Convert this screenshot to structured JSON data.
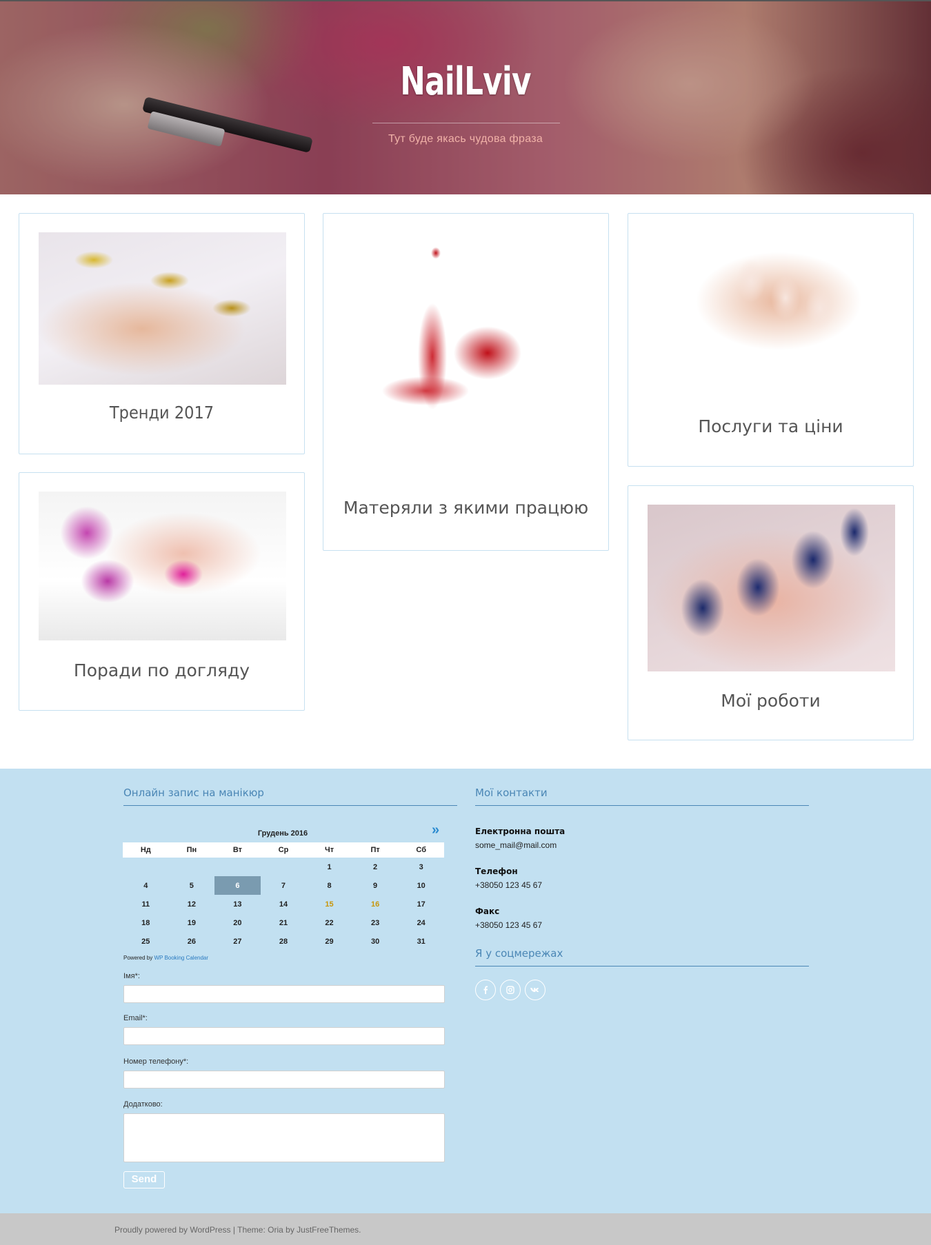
{
  "header": {
    "site_title": "NailLviv",
    "tagline": "Тут буде якась чудова фраза"
  },
  "cards": [
    {
      "title": "Тренди 2017",
      "image": "gold-nails-photo"
    },
    {
      "title": "Матеряли з якими працюю",
      "image": "red-nail-polish-photo"
    },
    {
      "title": "Послуги та ціни",
      "image": "french-manicure-photo"
    },
    {
      "title": "Поради по догляду",
      "image": "pink-nails-orchid-photo"
    },
    {
      "title": "Мої роботи",
      "image": "navy-nail-art-photo"
    }
  ],
  "booking": {
    "widget_title": "Онлайн запис на манікюр",
    "calendar": {
      "month": "Грудень 2016",
      "next_label": "»",
      "weekdays": [
        "Нд",
        "Пн",
        "Вт",
        "Ср",
        "Чт",
        "Пт",
        "Сб"
      ],
      "weeks": [
        [
          "",
          "",
          "",
          "",
          "1",
          "2",
          "3"
        ],
        [
          "4",
          "5",
          "6",
          "7",
          "8",
          "9",
          "10"
        ],
        [
          "11",
          "12",
          "13",
          "14",
          "15",
          "16",
          "17"
        ],
        [
          "18",
          "19",
          "20",
          "21",
          "22",
          "23",
          "24"
        ],
        [
          "25",
          "26",
          "27",
          "28",
          "29",
          "30",
          "31"
        ]
      ],
      "today": "6",
      "highlighted": [
        "15",
        "16"
      ]
    },
    "powered_prefix": "Powered by",
    "powered_link": "WP Booking Calendar",
    "form": {
      "name_label": "Імя*:",
      "email_label": "Email*:",
      "phone_label": "Номер телефону*:",
      "extra_label": "Додатково:",
      "send_label": "Send"
    }
  },
  "contacts": {
    "widget_title": "Мої контакти",
    "email_label": "Електронна пошта",
    "email_value": "some_mail@mail.com",
    "phone_label": "Телефон",
    "phone_value": "+38050 123 45 67",
    "fax_label": "Факс",
    "fax_value": "+38050 123 45 67"
  },
  "social": {
    "widget_title": "Я у соцмережах",
    "icons": [
      "facebook-icon",
      "instagram-icon",
      "vk-icon"
    ]
  },
  "footer": {
    "powered_text": "Proudly powered by WordPress",
    "separator": "|",
    "theme_text": "Theme: Oria by JustFreeThemes."
  },
  "colors": {
    "widget_bg": "#c2e0f1",
    "accent": "#4a86b5",
    "card_border": "#c6e0f0",
    "today_bg": "#7a9bb0",
    "highlight_day": "#c8960a"
  }
}
